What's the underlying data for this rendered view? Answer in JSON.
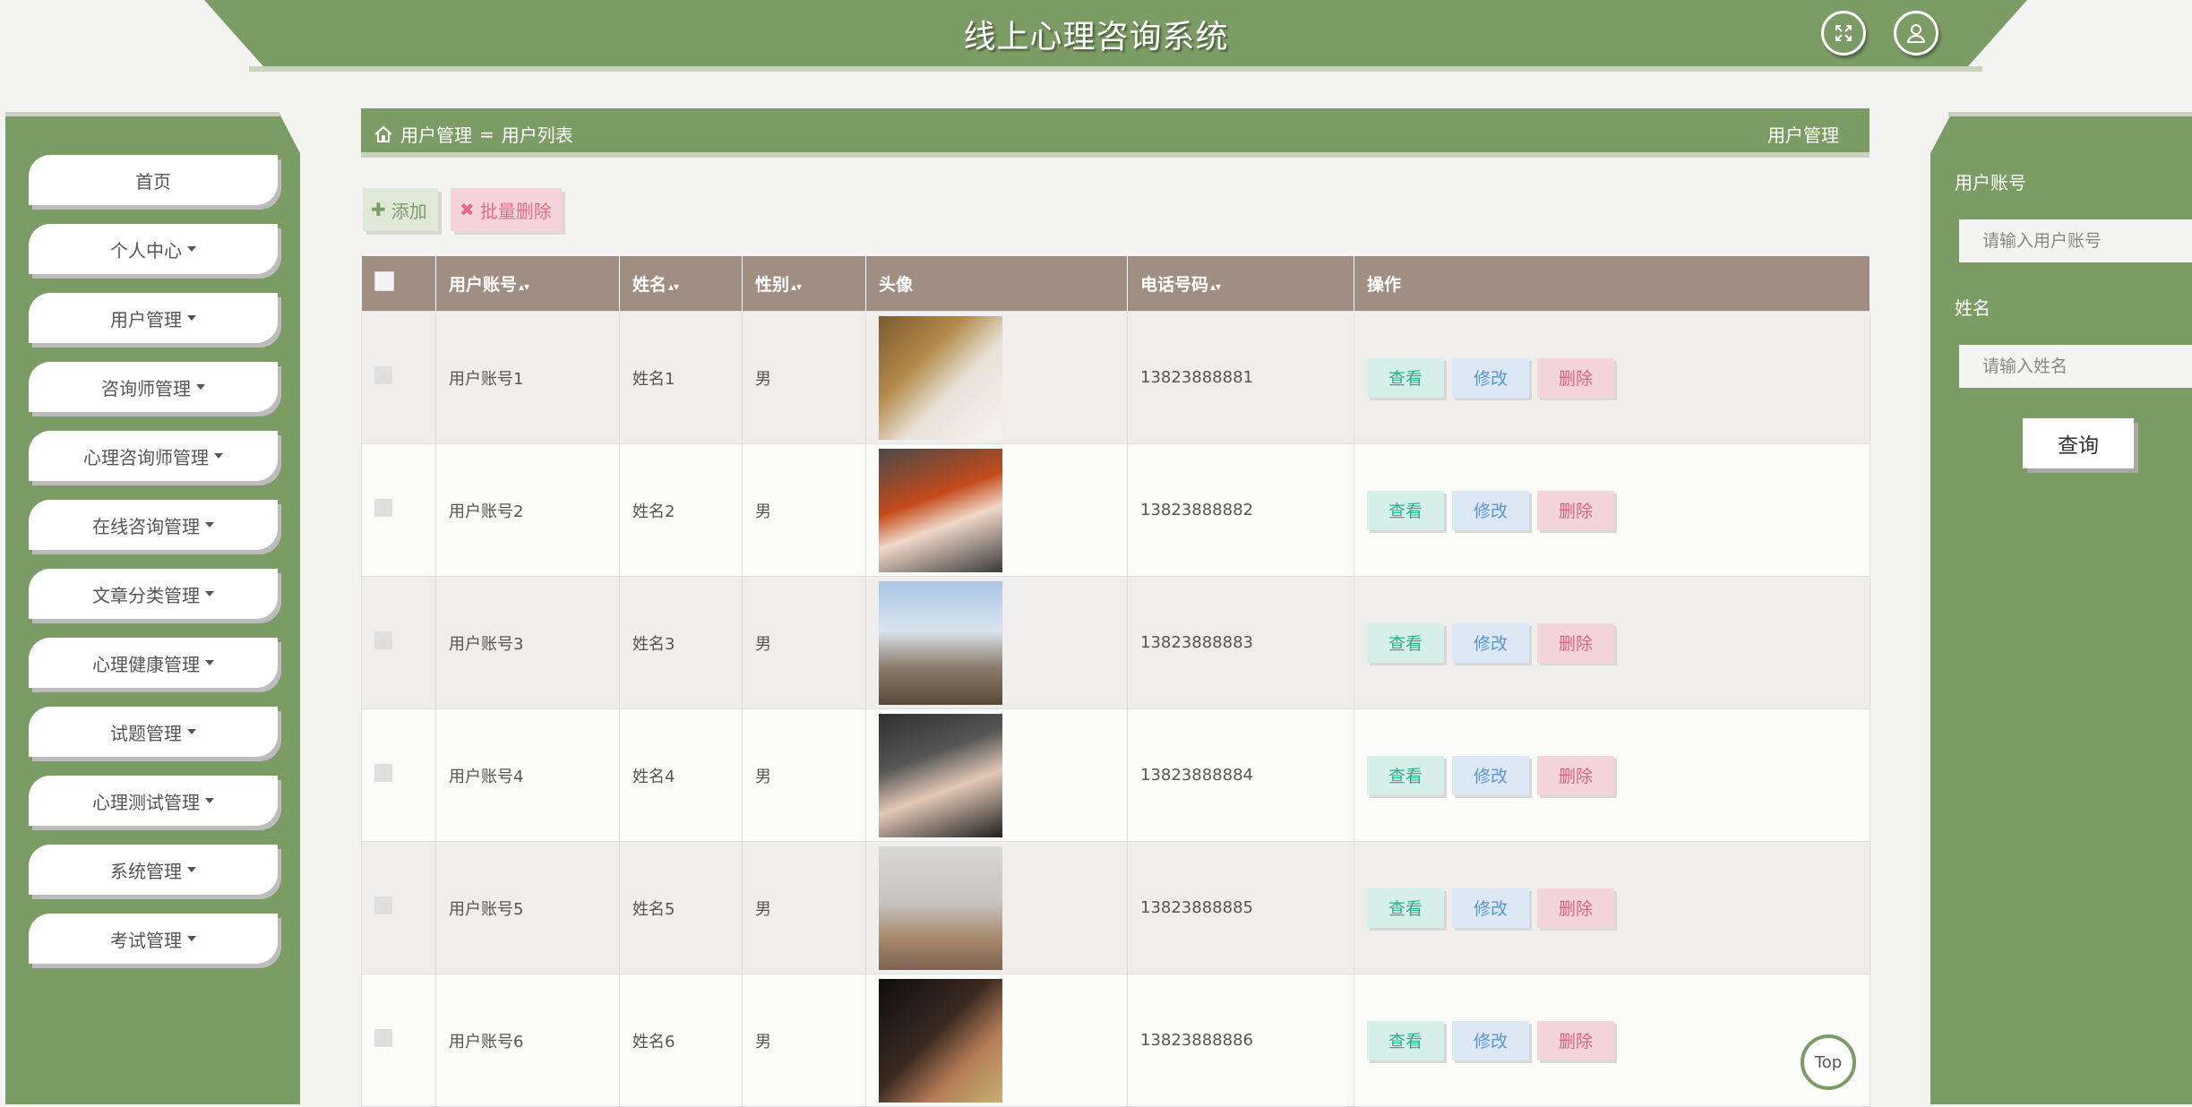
{
  "header": {
    "title": "线上心理咨询系统"
  },
  "sidebar": {
    "items": [
      {
        "label": "首页",
        "dropdown": false
      },
      {
        "label": "个人中心",
        "dropdown": true
      },
      {
        "label": "用户管理",
        "dropdown": true
      },
      {
        "label": "咨询师管理",
        "dropdown": true
      },
      {
        "label": "心理咨询师管理",
        "dropdown": true
      },
      {
        "label": "在线咨询管理",
        "dropdown": true
      },
      {
        "label": "文章分类管理",
        "dropdown": true
      },
      {
        "label": "心理健康管理",
        "dropdown": true
      },
      {
        "label": "试题管理",
        "dropdown": true
      },
      {
        "label": "心理测试管理",
        "dropdown": true
      },
      {
        "label": "系统管理",
        "dropdown": true
      },
      {
        "label": "考试管理",
        "dropdown": true
      }
    ]
  },
  "breadcrumb": {
    "first": "用户管理",
    "separator": "=",
    "second": "用户列表",
    "right": "用户管理"
  },
  "toolbar": {
    "add_label": "添加",
    "batch_delete_label": "批量删除"
  },
  "table": {
    "headers": {
      "account": "用户账号",
      "name": "姓名",
      "gender": "性别",
      "avatar": "头像",
      "phone": "电话号码",
      "actions": "操作"
    },
    "actions": {
      "view": "查看",
      "edit": "修改",
      "delete": "删除"
    },
    "rows": [
      {
        "account": "用户账号1",
        "name": "姓名1",
        "gender": "男",
        "phone": "13823888881"
      },
      {
        "account": "用户账号2",
        "name": "姓名2",
        "gender": "男",
        "phone": "13823888882"
      },
      {
        "account": "用户账号3",
        "name": "姓名3",
        "gender": "男",
        "phone": "13823888883"
      },
      {
        "account": "用户账号4",
        "name": "姓名4",
        "gender": "男",
        "phone": "13823888884"
      },
      {
        "account": "用户账号5",
        "name": "姓名5",
        "gender": "男",
        "phone": "13823888885"
      },
      {
        "account": "用户账号6",
        "name": "姓名6",
        "gender": "男",
        "phone": "13823888886"
      }
    ]
  },
  "search": {
    "account_label": "用户账号",
    "account_placeholder": "请输入用户账号",
    "name_label": "姓名",
    "name_placeholder": "请输入姓名",
    "query_label": "查询"
  },
  "top_label": "Top",
  "colors": {
    "primary": "#7b9c64",
    "table_header": "#a08e82",
    "view": "#2fae8e",
    "edit": "#5696d6",
    "delete": "#e0607c"
  }
}
